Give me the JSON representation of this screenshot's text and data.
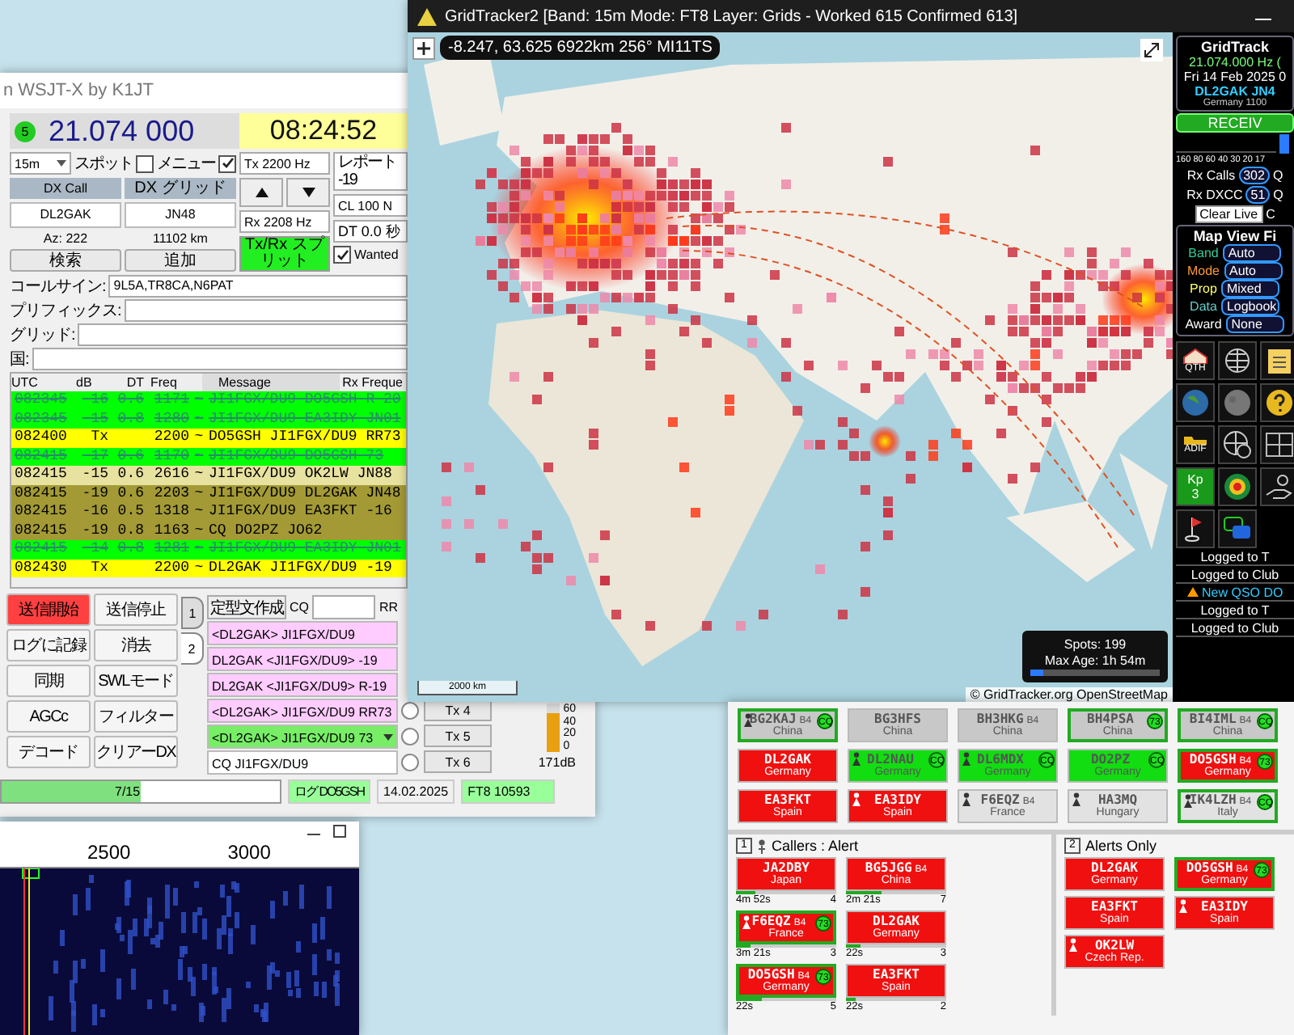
{
  "wsjtx": {
    "title": "n WSJT-X by K1JT",
    "status_led": "5",
    "frequency": "21.074 000",
    "clock": "08:24:52",
    "band": "15m",
    "spot": {
      "label": "スポット",
      "checked": false
    },
    "menu": {
      "label": "メニュー",
      "checked": true
    },
    "dx_call_label": "DX Call",
    "dx_grid_label": "DX グリッド",
    "dx_call": "DL2GAK",
    "dx_grid": "JN48",
    "azimuth": "Az: 222",
    "distance": "11102 km",
    "lookup_button": "検索",
    "add_button": "追加",
    "tx_freq": "Tx  2200  Hz",
    "rx_freq": "Rx  2208  Hz",
    "split_button": {
      "label": "Tx/Rx スプリット",
      "on": true
    },
    "report": "レポート -19",
    "cl": "CL  100 N",
    "dt": "DT 0.0 秒",
    "wanted": {
      "label": "Wanted",
      "checked": true
    },
    "filters": [
      {
        "label": "コールサイン:",
        "value": "9L5A,TR8CA,N6PAT"
      },
      {
        "label": "プリフィックス:"
      },
      {
        "label": "グリッド:"
      },
      {
        "label": "国:"
      }
    ],
    "decode": {
      "columns": [
        "UTC",
        "dB",
        "DT",
        "Freq",
        "Message",
        "Rx Freque"
      ],
      "rows": [
        {
          "utc": "082345",
          "db": "-16",
          "dt": "0.6",
          "freq": "1171",
          "mode": "~",
          "message": "JI1FGX/DU9 DO5GSH R-20",
          "color": "#00ff00",
          "struck": true
        },
        {
          "utc": "082345",
          "db": "-15",
          "dt": "0.8",
          "freq": "1280",
          "mode": "~",
          "message": "JI1FGX/DU9 EA3IDY JN01",
          "color": "#00ff00",
          "struck": true
        },
        {
          "utc": "082400",
          "db": "Tx",
          "freq": "2200",
          "mode": "~",
          "message": "DO5GSH JI1FGX/DU9 RR73",
          "color": "#ffff00",
          "struck": false
        },
        {
          "utc": "082415",
          "db": "-17",
          "dt": "0.6",
          "freq": "1170",
          "mode": "~",
          "message": "JI1FGX/DU9 DO5GSH 73",
          "color": "#00ff00",
          "struck": true
        },
        {
          "utc": "082415",
          "db": "-15",
          "dt": "0.6",
          "freq": "2616",
          "mode": "~",
          "message": "JI1FGX/DU9 OK2LW JN88",
          "color": "#e8e2a0",
          "struck": false
        },
        {
          "utc": "082415",
          "db": "-19",
          "dt": "0.6",
          "freq": "2203",
          "mode": "~",
          "message": "JI1FGX/DU9 DL2GAK JN48",
          "color": "#a39a36",
          "struck": false
        },
        {
          "utc": "082415",
          "db": "-16",
          "dt": "0.5",
          "freq": "1318",
          "mode": "~",
          "message": "JI1FGX/DU9 EA3FKT -16",
          "color": "#a39a36",
          "struck": false
        },
        {
          "utc": "082415",
          "db": "-19",
          "dt": "0.8",
          "freq": "1163",
          "mode": "~",
          "message": "CQ DO2PZ JO62",
          "color": "#a39a36",
          "struck": false
        },
        {
          "utc": "082415",
          "db": "-14",
          "dt": "0.8",
          "freq": "1281",
          "mode": "~",
          "message": "JI1FGX/DU9 EA3IDY JN01",
          "color": "#00ff00",
          "struck": true
        },
        {
          "utc": "082430",
          "db": "Tx",
          "freq": "2200",
          "mode": "~",
          "message": "DL2GAK JI1FGX/DU9 -19",
          "color": "#ffff00",
          "struck": false
        }
      ]
    },
    "buttons": [
      {
        "label": "送信開始",
        "on": true
      },
      {
        "label": "送信停止",
        "on": false
      },
      {
        "label": "ログに記録",
        "on": false
      },
      {
        "label": "消去",
        "on": false
      },
      {
        "label": "同期",
        "on": false
      },
      {
        "label": "SWLモード",
        "on": false
      },
      {
        "label": "AGCc",
        "on": false
      },
      {
        "label": "フィルター",
        "on": false
      },
      {
        "label": "デコード",
        "on": false
      },
      {
        "label": "クリアーDX",
        "on": false
      }
    ],
    "tabs": [
      {
        "label": "1",
        "selected": false
      },
      {
        "label": "2",
        "selected": true
      }
    ],
    "generator": {
      "button": "定型文作成",
      "cq_label": "CQ",
      "rr_label": "RR"
    },
    "messages": [
      {
        "text": "<DL2GAK> JI1FGX/DU9",
        "color": "#ffccff",
        "dropdown": false
      },
      {
        "text": "DL2GAK <JI1FGX/DU9> -19",
        "color": "#ffccff",
        "dropdown": false
      },
      {
        "text": "DL2GAK <JI1FGX/DU9> R-19",
        "color": "#ffccff",
        "dropdown": false
      },
      {
        "text": "<DL2GAK> JI1FGX/DU9 RR73",
        "color": "#ffccff",
        "dropdown": false,
        "tx": {
          "label": "Tx 4",
          "selected": false
        }
      },
      {
        "text": "<DL2GAK> JI1FGX/DU9 73",
        "color": "#77ee66",
        "dropdown": true,
        "tx": {
          "label": "Tx 5",
          "selected": false
        }
      },
      {
        "text": "CQ JI1FGX/DU9",
        "color": "#ffffff",
        "dropdown": false,
        "tx": {
          "label": "Tx 6",
          "selected": false
        }
      }
    ],
    "meter": {
      "ticks": [
        "60",
        "40",
        "20",
        "0"
      ],
      "level": 0.8,
      "reading": "171dB"
    },
    "status_bar": {
      "progress": {
        "text": "7/15",
        "level": 0.5
      },
      "log": "ログ DO5GSH",
      "date": "14.02.2025",
      "mode": "FT8  10593"
    }
  },
  "waterfall": {
    "scale": [
      "2500",
      "3000"
    ]
  },
  "gridtracker": {
    "title": "GridTracker2 [Band: 15m Mode: FT8 Layer: Grids - Worked 615 Confirmed 613]",
    "coords": "-8.247, 63.625 6922km 256° MI11TS",
    "spots": "Spots: 199",
    "max_age": "Max Age: 1h 54m",
    "age_slider": {
      "level": 0.1
    },
    "scale": "2000 km",
    "attribution": "© GridTracker.org OpenStreetMap",
    "panel": {
      "title": "GridTrack",
      "frequency": "21.074.000 Hz (",
      "date": "Fri 14 Feb 2025 0",
      "station": "DL2GAK  JN4",
      "location": "Germany  1100",
      "status": "RECEIV",
      "bands": "160 80 60 40 30 20 17",
      "rx_calls": {
        "label": "Rx Calls",
        "count": "302",
        "tail": "Q"
      },
      "rx_dxcc": {
        "label": "Rx DXCC",
        "count": "51",
        "tail": "Q"
      },
      "clear_button": "Clear Live",
      "clear_tail": "C",
      "filter_title": "Map View Fi",
      "filters": [
        {
          "label": "Band",
          "value": "Auto",
          "color": "#33cc99"
        },
        {
          "label": "Mode",
          "value": "Auto",
          "color": "#ff9933"
        },
        {
          "label": "Prop",
          "value": "Mixed",
          "color": "#ffff66"
        },
        {
          "label": "Data",
          "value": "Logbook",
          "color": "#66cccc"
        },
        {
          "label": "Award",
          "value": "None",
          "color": "#ffffff"
        }
      ],
      "icons": [
        {
          "kind": "qth",
          "label": "QTH"
        },
        {
          "kind": "globe-grid"
        },
        {
          "kind": "clipboard"
        },
        {
          "kind": "earth"
        },
        {
          "kind": "moon"
        },
        {
          "kind": "help"
        },
        {
          "kind": "adif",
          "label": "ADIF"
        },
        {
          "kind": "globe-clock"
        },
        {
          "kind": "grid"
        },
        {
          "kind": "kp",
          "label": "Kp",
          "value": "3"
        },
        {
          "kind": "heat"
        },
        {
          "kind": "hand"
        },
        {
          "kind": "flag"
        },
        {
          "kind": "chat"
        }
      ],
      "log": [
        {
          "text": "Logged to T",
          "kind": "info"
        },
        {
          "text": "Logged to Club",
          "kind": "info"
        },
        {
          "text": "New QSO DO",
          "kind": "warning"
        },
        {
          "text": "Logged to T",
          "kind": "info"
        },
        {
          "text": "Logged to Club",
          "kind": "info"
        }
      ]
    }
  },
  "roster": {
    "cards": [
      {
        "call": "BG2KAJ",
        "zone": "B4",
        "country": "China",
        "color": "#c8c8c8",
        "outline": true,
        "badge": "CQ",
        "marker": true
      },
      {
        "call": "BG3HFS",
        "country": "China",
        "color": "#c8c8c8",
        "outline": false,
        "marker": false
      },
      {
        "call": "BH3HKG",
        "zone": "B4",
        "country": "China",
        "color": "#c8c8c8",
        "outline": false,
        "marker": false
      },
      {
        "call": "BH4PSA",
        "country": "China",
        "color": "#c8c8c8",
        "outline": true,
        "badge": "73",
        "marker": false
      },
      {
        "call": "BI4IML",
        "zone": "B4",
        "country": "China",
        "color": "#c8c8c8",
        "outline": true,
        "badge": "CQ",
        "marker": false
      },
      {
        "call": "DL2GAK",
        "country": "Germany",
        "color": "#f01010",
        "outline": false,
        "marker": false
      },
      {
        "call": "DL2NAU",
        "country": "Germany",
        "color": "#11dd11",
        "outline": false,
        "badge": "CQ",
        "marker": true
      },
      {
        "call": "DL6MDX",
        "country": "Germany",
        "color": "#11dd11",
        "outline": false,
        "badge": "CQ",
        "marker": true
      },
      {
        "call": "DO2PZ",
        "country": "Germany",
        "color": "#11dd11",
        "outline": false,
        "badge": "CQ",
        "marker": false
      },
      {
        "call": "DO5GSH",
        "zone": "B4",
        "country": "Germany",
        "color": "#f01010",
        "outline": true,
        "badge": "73",
        "marker": false
      },
      {
        "call": "EA3FKT",
        "country": "Spain",
        "color": "#f01010",
        "outline": false,
        "marker": false
      },
      {
        "call": "EA3IDY",
        "country": "Spain",
        "color": "#f01010",
        "outline": false,
        "marker": true
      },
      {
        "call": "F6EQZ",
        "zone": "B4",
        "country": "France",
        "color": "#e2e2e2",
        "outline": false,
        "marker": true
      },
      {
        "call": "HA3MQ",
        "country": "Hungary",
        "color": "#e2e2e2",
        "outline": false,
        "marker": true
      },
      {
        "call": "IK4LZH",
        "zone": "B4",
        "country": "Italy",
        "color": "#e2e2e2",
        "outline": true,
        "badge": "CQ",
        "marker": true
      }
    ],
    "panes": [
      {
        "number": "1",
        "kind": "callers",
        "title": "Callers : Alert",
        "cards": [
          {
            "call": "JA2DBY",
            "country": "Japan",
            "color": "#f01010",
            "outline": false,
            "marker": false,
            "time": "4m 52s",
            "count": "4",
            "level": 0.2
          },
          {
            "call": "BG5JGG",
            "zone": "B4",
            "country": "China",
            "color": "#f01010",
            "outline": false,
            "marker": false,
            "time": "2m 21s",
            "count": "7",
            "level": 0.35
          },
          {
            "call": "F6EQZ",
            "zone": "B4",
            "country": "France",
            "color": "#f01010",
            "outline": true,
            "badge": "73",
            "marker": true,
            "time": "3m 21s",
            "count": "3",
            "level": 0.15
          },
          {
            "call": "DL2GAK",
            "country": "Germany",
            "color": "#f01010",
            "outline": false,
            "marker": false,
            "time": "22s",
            "count": "3",
            "level": 0.15
          },
          {
            "call": "DO5GSH",
            "zone": "B4",
            "country": "Germany",
            "color": "#f01010",
            "outline": true,
            "badge": "73",
            "marker": false,
            "time": "22s",
            "count": "5",
            "level": 0.25
          },
          {
            "call": "EA3FKT",
            "country": "Spain",
            "color": "#f01010",
            "outline": false,
            "marker": false,
            "time": "22s",
            "count": "2",
            "level": 0.1
          }
        ]
      },
      {
        "number": "2",
        "kind": "alerts",
        "title": "Alerts Only",
        "cards": [
          {
            "call": "DL2GAK",
            "country": "Germany",
            "color": "#f01010",
            "outline": false,
            "marker": false
          },
          {
            "call": "DO5GSH",
            "zone": "B4",
            "country": "Germany",
            "color": "#f01010",
            "outline": true,
            "badge": "73",
            "marker": false
          },
          {
            "call": "EA3FKT",
            "country": "Spain",
            "color": "#f01010",
            "outline": false,
            "marker": false
          },
          {
            "call": "EA3IDY",
            "country": "Spain",
            "color": "#f01010",
            "outline": false,
            "marker": true
          },
          {
            "call": "OK2LW",
            "country": "Czech Rep.",
            "color": "#f01010",
            "outline": false,
            "marker": true
          }
        ]
      }
    ]
  }
}
